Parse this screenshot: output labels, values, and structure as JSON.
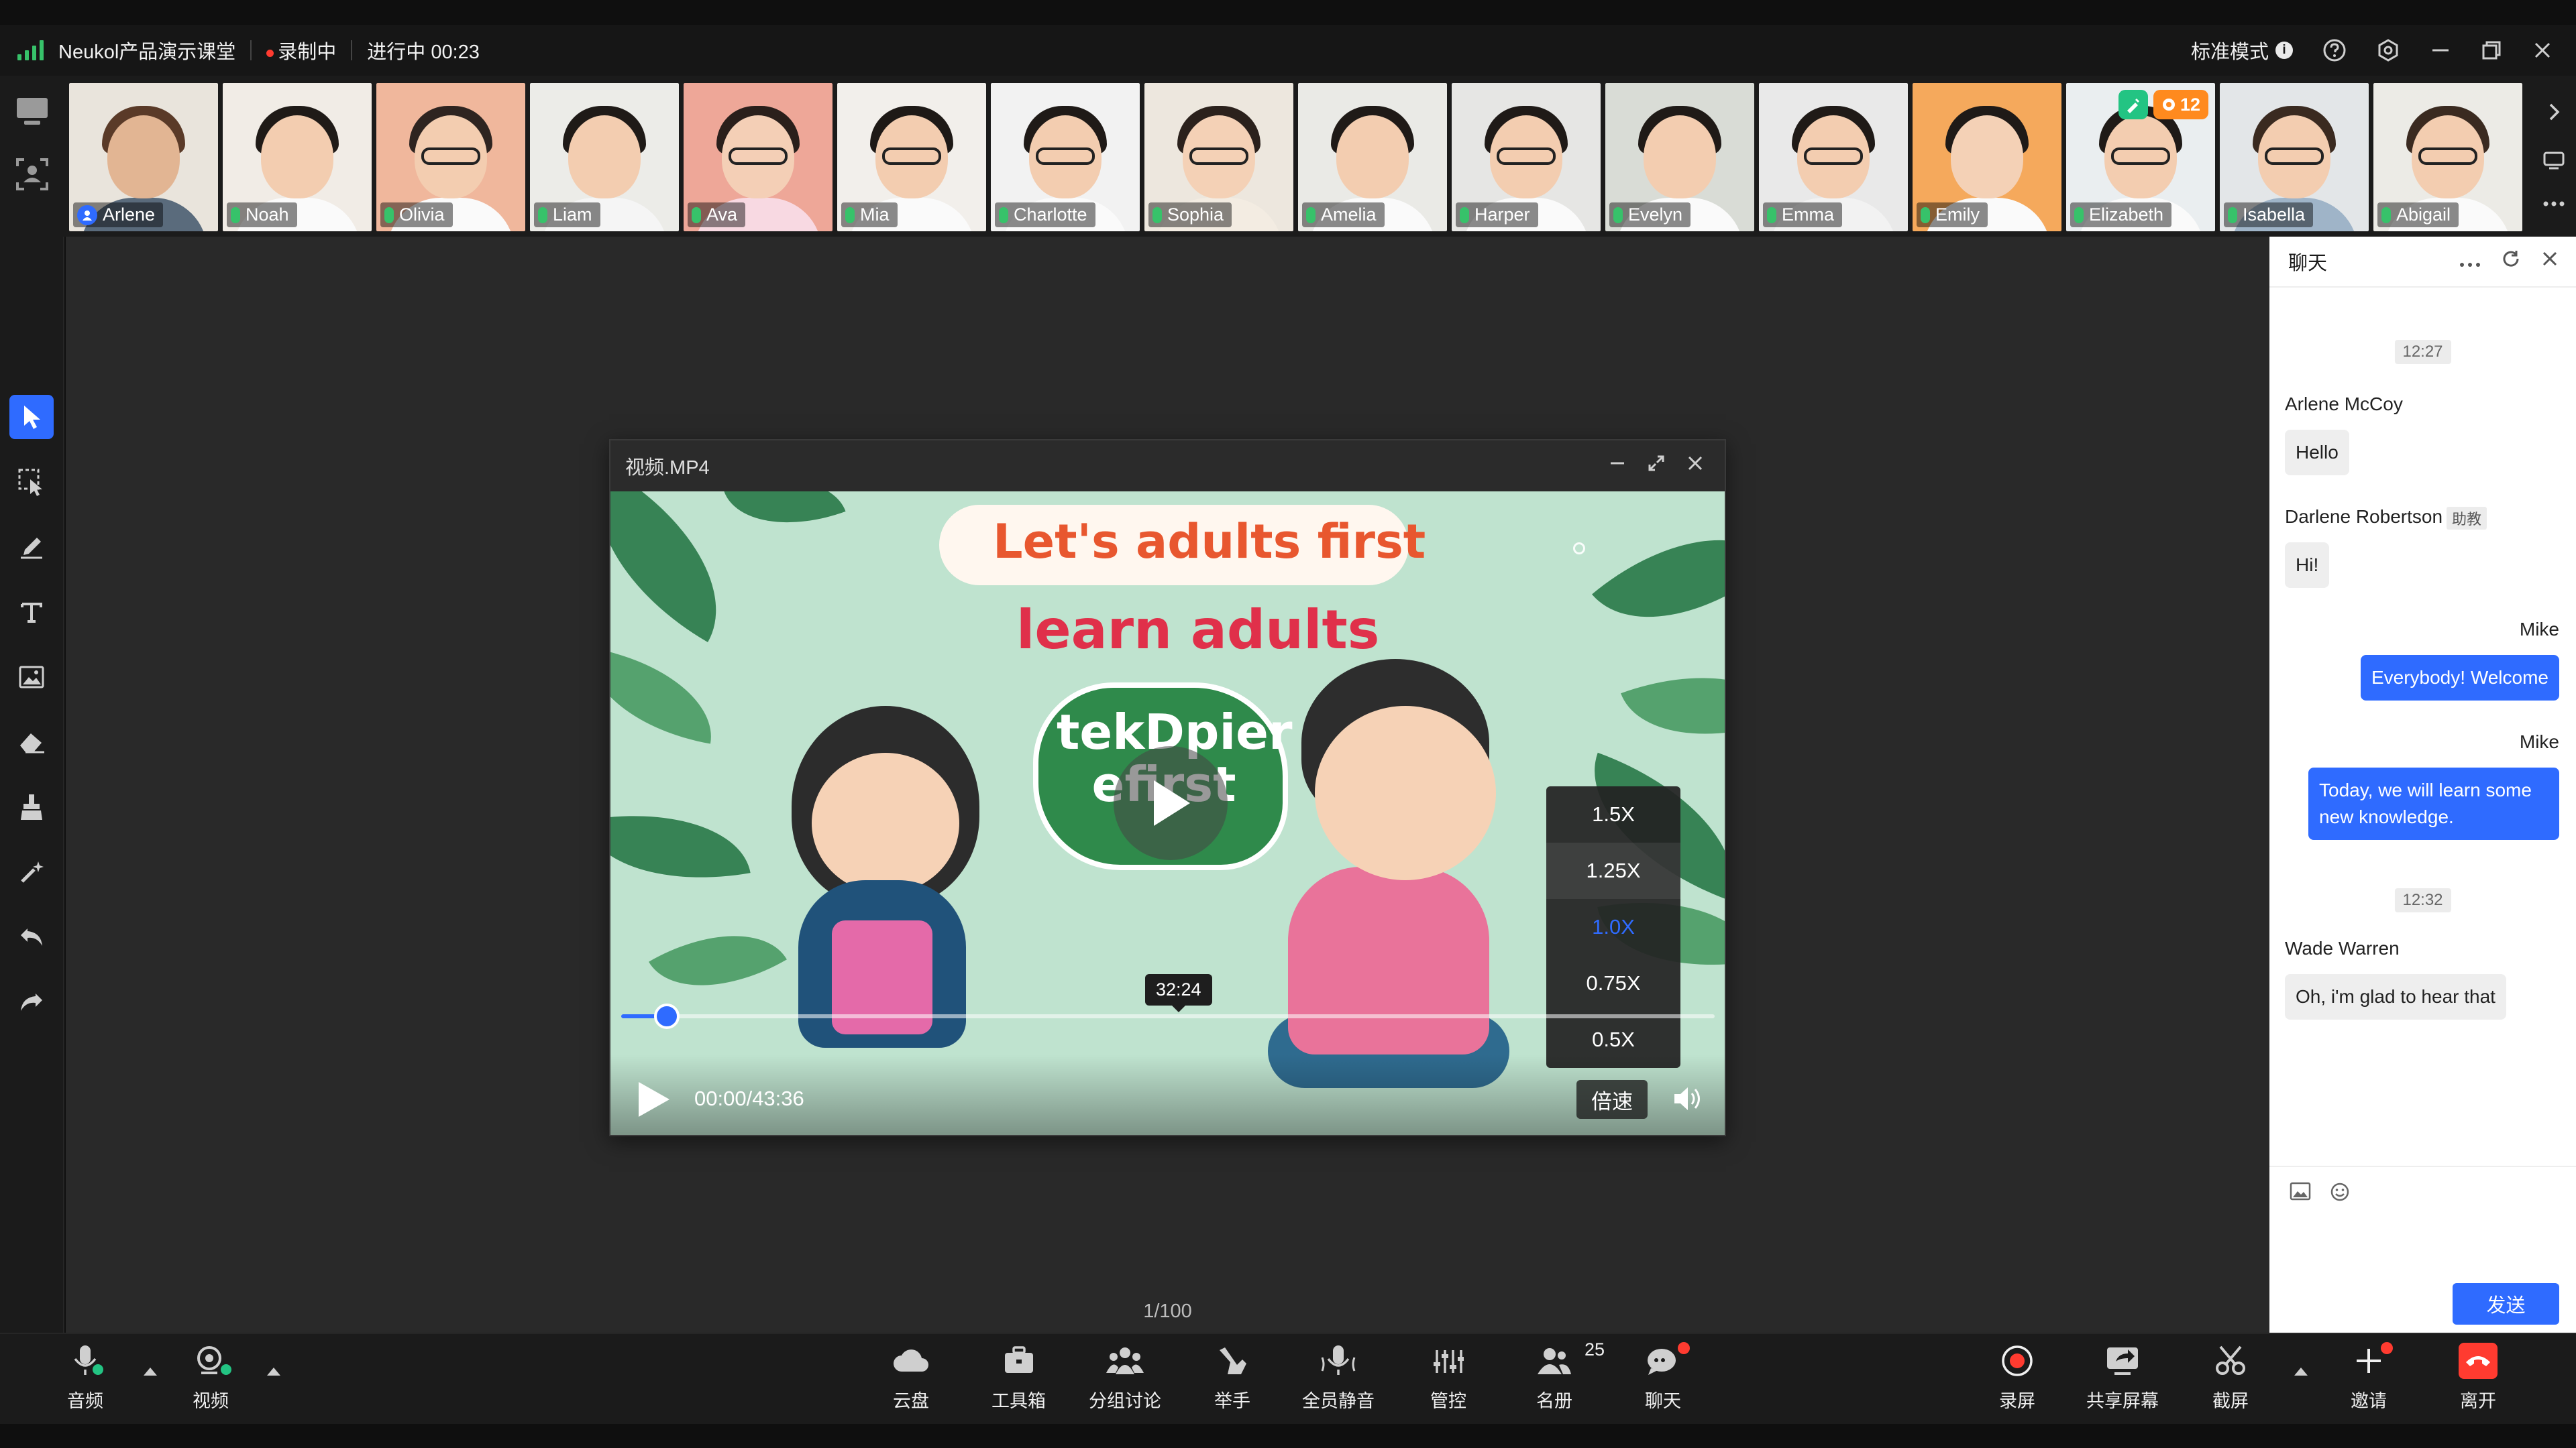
{
  "titlebar": {
    "app_title": "Neukol产品演示课堂",
    "recording_label": "录制中",
    "session_status": "进行中 00:23",
    "mode_label": "标准模式",
    "info_glyph": "i"
  },
  "participants": [
    {
      "name": "Arlene",
      "role": "host"
    },
    {
      "name": "Noah"
    },
    {
      "name": "Olivia"
    },
    {
      "name": "Liam"
    },
    {
      "name": "Ava"
    },
    {
      "name": "Mia"
    },
    {
      "name": "Charlotte"
    },
    {
      "name": "Sophia"
    },
    {
      "name": "Amelia"
    },
    {
      "name": "Harper"
    },
    {
      "name": "Evelyn"
    },
    {
      "name": "Emma"
    },
    {
      "name": "Emily"
    },
    {
      "name": "Elizabeth",
      "reward_count": "12"
    },
    {
      "name": "Isabella"
    },
    {
      "name": "Abigail"
    }
  ],
  "video": {
    "window_title": "视频.MP4",
    "headline_1": "Let's adults first",
    "headline_2": "learn adults",
    "badge_text": "tekDpier efirst",
    "time_display": "00:00/43:36",
    "hover_time": "32:24",
    "progress_fraction": 0.042,
    "speed_button": "倍速",
    "speed_options": [
      "1.5X",
      "1.25X",
      "1.0X",
      "0.75X",
      "0.5X"
    ],
    "speed_selected": "1.0X",
    "speed_hovered": "1.25X"
  },
  "stage": {
    "page_counter": "1/100"
  },
  "chat": {
    "title": "聊天",
    "messages": {
      "t1": "12:27",
      "m1_sender": "Arlene McCoy",
      "m1_text": "Hello",
      "m2_sender": "Darlene Robertson",
      "m2_tag": "助教",
      "m2_text": "Hi!",
      "m3_sender": "Mike",
      "m3_text": "Everybody! Welcome",
      "m4_sender": "Mike",
      "m4_text": "Today, we will learn some new knowledge.",
      "t2": "12:32",
      "m5_sender": "Wade Warren",
      "m5_text": "Oh, i'm glad to hear that"
    },
    "input_placeholder": "",
    "send_label": "发送"
  },
  "bottombar": {
    "audio": "音频",
    "video": "视频",
    "cloud": "云盘",
    "toolbox": "工具箱",
    "breakout": "分组讨论",
    "raise_hand": "举手",
    "mute_all": "全员静音",
    "control": "管控",
    "roster": "名册",
    "roster_count": "25",
    "chat": "聊天",
    "record": "录屏",
    "share": "共享屏幕",
    "screenshot": "截屏",
    "invite": "邀请",
    "leave": "离开"
  },
  "colors": {
    "accent": "#2f6bff",
    "danger": "#ff3b30",
    "success": "#37c26a"
  }
}
